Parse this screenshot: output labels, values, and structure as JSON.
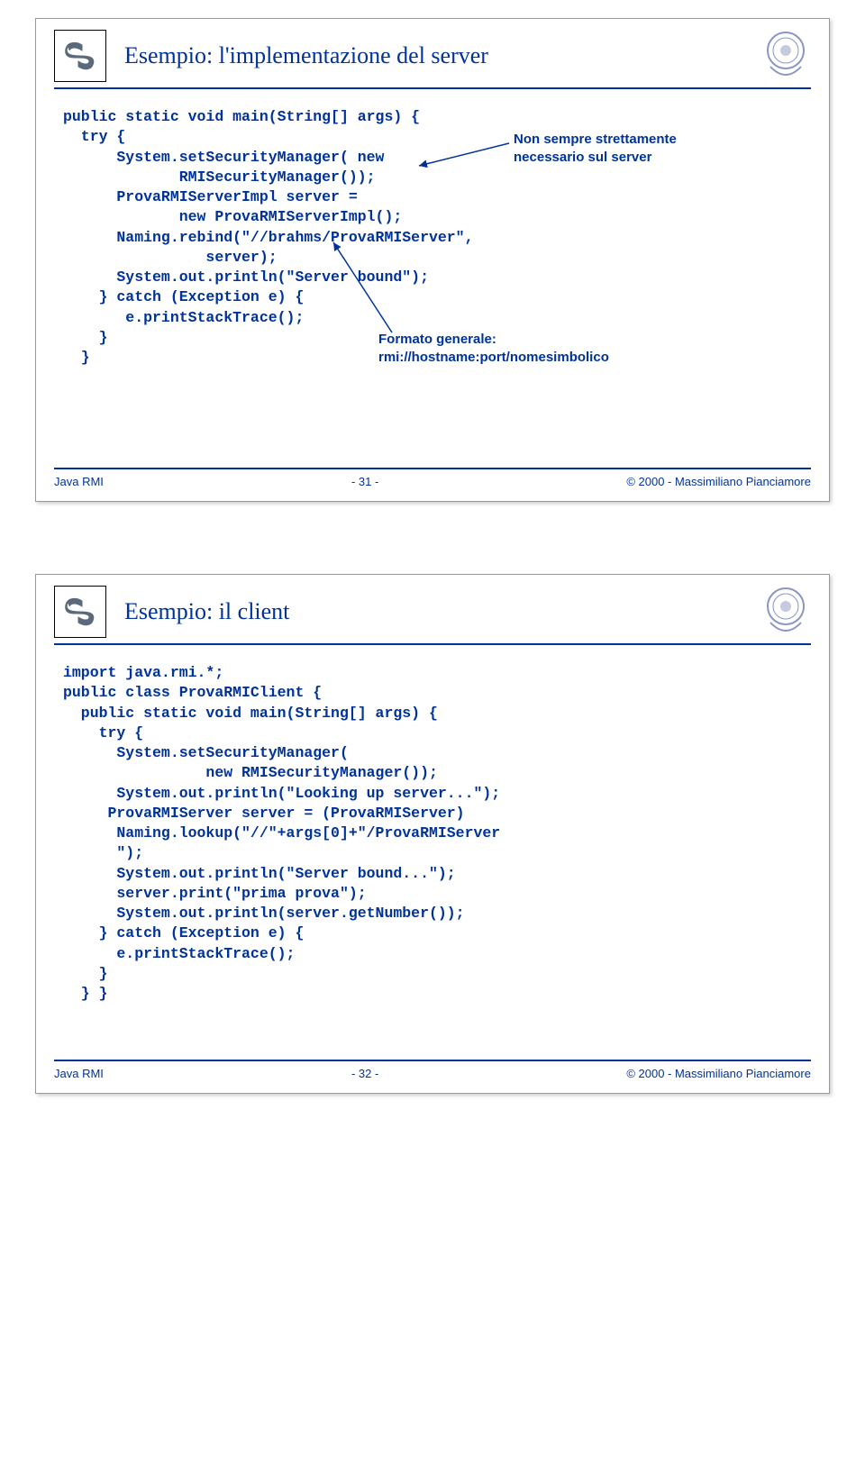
{
  "slide1": {
    "title": "Esempio: l'implementazione del server",
    "code": "public static void main(String[] args) {\n  try {\n      System.setSecurityManager( new\n             RMISecurityManager());\n      ProvaRMIServerImpl server =\n             new ProvaRMIServerImpl();\n      Naming.rebind(\"//brahms/ProvaRMIServer\",\n                server);\n      System.out.println(\"Server bound\");\n    } catch (Exception e) {\n       e.printStackTrace();\n    }\n  }",
    "annotation1": "Non sempre strettamente\nnecessario sul server",
    "annotation2": "Formato generale:\nrmi://hostname:port/nomesimbolico",
    "footer_left": "Java RMI",
    "footer_center": "- 31 -",
    "footer_right": "© 2000 - Massimiliano Pianciamore"
  },
  "slide2": {
    "title": "Esempio: il client",
    "code": "import java.rmi.*;\npublic class ProvaRMIClient {\n  public static void main(String[] args) {\n    try {\n      System.setSecurityManager(\n                new RMISecurityManager());\n      System.out.println(\"Looking up server...\");\n     ProvaRMIServer server = (ProvaRMIServer)\n      Naming.lookup(\"//\"+args[0]+\"/ProvaRMIServer\n      \");\n      System.out.println(\"Server bound...\");\n      server.print(\"prima prova\");\n      System.out.println(server.getNumber());\n    } catch (Exception e) {\n      e.printStackTrace();\n    }\n  } }",
    "footer_left": "Java RMI",
    "footer_center": "- 32 -",
    "footer_right": "© 2000 - Massimiliano Pianciamore"
  }
}
